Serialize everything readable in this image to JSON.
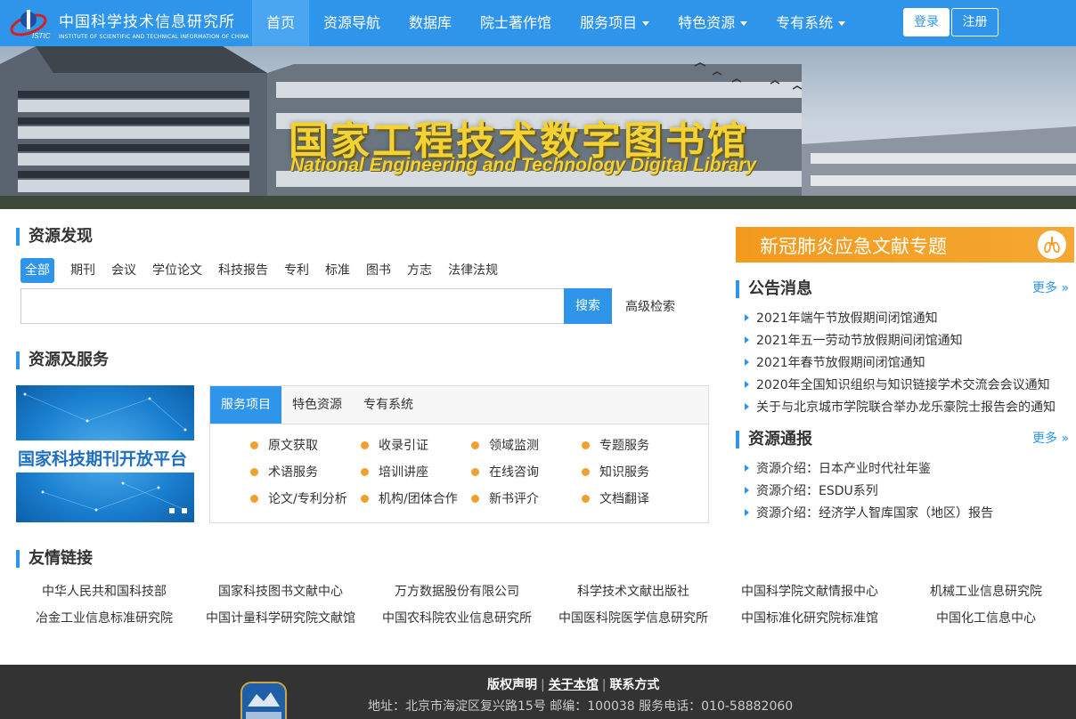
{
  "header": {
    "logo_cn": "中国科学技术信息研究所",
    "logo_en": "INSTITUTE OF SCIENTIFIC AND TECHNICAL INFORMATION OF CHINA",
    "logo_mark": "ISTIC",
    "nav": [
      {
        "label": "首页",
        "active": true
      },
      {
        "label": "资源导航"
      },
      {
        "label": "数据库"
      },
      {
        "label": "院士著作馆"
      },
      {
        "label": "服务项目",
        "dropdown": true
      },
      {
        "label": "特色资源",
        "dropdown": true
      },
      {
        "label": "专有系统",
        "dropdown": true
      }
    ],
    "login": "登录",
    "register": "注册"
  },
  "banner": {
    "title_cn": "国家工程技术数字图书馆",
    "title_en": "National Engineering and Technology Digital Library"
  },
  "discovery": {
    "title": "资源发现",
    "tabs": [
      "全部",
      "期刊",
      "会议",
      "学位论文",
      "科技报告",
      "专利",
      "标准",
      "图书",
      "方志",
      "法律法规"
    ],
    "search_placeholder": "",
    "search_button": "搜索",
    "advanced": "高级检索"
  },
  "services": {
    "title": "资源及服务",
    "journal_banner": "国家科技期刊开放平台",
    "tabs": [
      "服务项目",
      "特色资源",
      "专有系统"
    ],
    "items": [
      "原文获取",
      "收录引证",
      "领域监测",
      "专题服务",
      "术语服务",
      "培训讲座",
      "在线咨询",
      "知识服务",
      "论文/专利分析",
      "机构/团体合作",
      "新书评介",
      "文档翻译"
    ]
  },
  "covid": {
    "label": "新冠肺炎应急文献专题"
  },
  "notices": {
    "title": "公告消息",
    "more": "更多 »",
    "items": [
      "2021年端午节放假期间闭馆通知",
      "2021年五一劳动节放假期间闭馆通知",
      "2021年春节放假期间闭馆通知",
      "2020年全国知识组织与知识链接学术交流会会议通知",
      "关于与北京城市学院联合举办龙乐豪院士报告会的通知"
    ]
  },
  "reports": {
    "title": "资源通报",
    "more": "更多 »",
    "items": [
      "资源介绍：日本产业时代社年鉴",
      "资源介绍：ESDU系列",
      "资源介绍：经济学人智库国家（地区）报告"
    ]
  },
  "friend_links": {
    "title": "友情链接",
    "items": [
      "中华人民共和国科技部",
      "国家科技图书文献中心",
      "万方数据股份有限公司",
      "科学技术文献出版社",
      "中国科学院文献情报中心",
      "机械工业信息研究院",
      "冶金工业信息标准研究院",
      "中国计量科学研究院文献馆",
      "中国农科院农业信息研究所",
      "中国医科院医学信息研究所",
      "中国标准化研究院标准馆",
      "中国化工信息中心"
    ]
  },
  "footer": {
    "copyright": "版权声明",
    "about": "关于本馆",
    "contact": "联系方式",
    "address": "地址：北京市海淀区复兴路15号 邮编：100038 服务电话：010-58882060"
  },
  "colors": {
    "primary": "#2f95ea",
    "accent": "#f39a1d",
    "footer": "#333333"
  }
}
